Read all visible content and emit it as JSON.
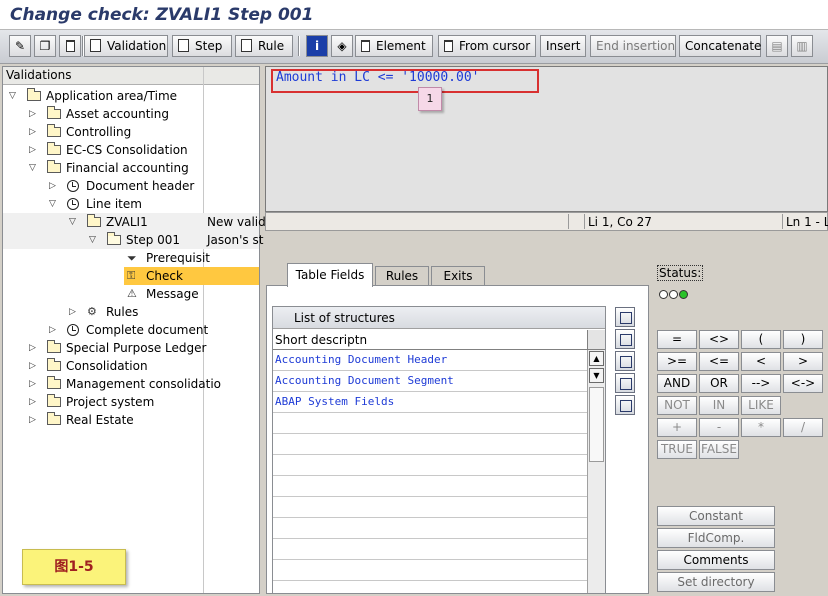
{
  "window": {
    "title": "Change check: ZVALI1 Step 001"
  },
  "toolbar": {
    "buttons": [
      "Validation",
      "Step",
      "Rule",
      "Element",
      "From cursor",
      "Insert",
      "End insertion",
      "Concatenate"
    ]
  },
  "tree": {
    "header": "Validations",
    "nodes": [
      {
        "label": "Application area/Time",
        "col2": ""
      },
      {
        "label": "Asset accounting",
        "col2": ""
      },
      {
        "label": "Controlling",
        "col2": ""
      },
      {
        "label": "EC-CS Consolidation",
        "col2": ""
      },
      {
        "label": "Financial accounting",
        "col2": ""
      },
      {
        "label": "Document header",
        "col2": ""
      },
      {
        "label": "Line item",
        "col2": ""
      },
      {
        "label": "ZVALI1",
        "col2": "New valid"
      },
      {
        "label": "Step 001",
        "col2": "Jason's st"
      },
      {
        "label": "Prerequisit",
        "col2": ""
      },
      {
        "label": "Check",
        "col2": ""
      },
      {
        "label": "Message",
        "col2": ""
      },
      {
        "label": "Rules",
        "col2": ""
      },
      {
        "label": "Complete document",
        "col2": ""
      },
      {
        "label": "Special Purpose Ledger",
        "col2": ""
      },
      {
        "label": "Consolidation",
        "col2": ""
      },
      {
        "label": "Management consolidatio",
        "col2": ""
      },
      {
        "label": "Project system",
        "col2": ""
      },
      {
        "label": "Real Estate",
        "col2": ""
      }
    ]
  },
  "editor": {
    "code": "Amount in LC <= '10000.00'",
    "callout": "1",
    "cursor": "Li 1, Co 27",
    "lines": "Ln 1 - L"
  },
  "tabs": [
    "Table Fields",
    "Rules",
    "Exits"
  ],
  "structures": {
    "title": "List of structures",
    "column": "Short descriptn",
    "rows": [
      "Accounting Document Header",
      "Accounting Document Segment",
      "ABAP System Fields"
    ]
  },
  "operators": {
    "status_label": "Status:",
    "rows": [
      [
        "=",
        "<>",
        "(",
        ")"
      ],
      [
        ">=",
        "<=",
        "<",
        ">"
      ],
      [
        "AND",
        "OR",
        "-->",
        "<->"
      ],
      [
        "NOT",
        "IN",
        "LIKE"
      ],
      [
        "+",
        "-",
        "*",
        "/"
      ],
      [
        "TRUE",
        "FALSE"
      ]
    ],
    "actions": [
      "Constant",
      "FldComp.",
      "Comments",
      "Set directory"
    ]
  },
  "figure_label": "图1-5",
  "colors": {
    "highlight": "#ffc840",
    "code_blue": "#1e3bd6",
    "title_navy": "#2a3a6a"
  }
}
